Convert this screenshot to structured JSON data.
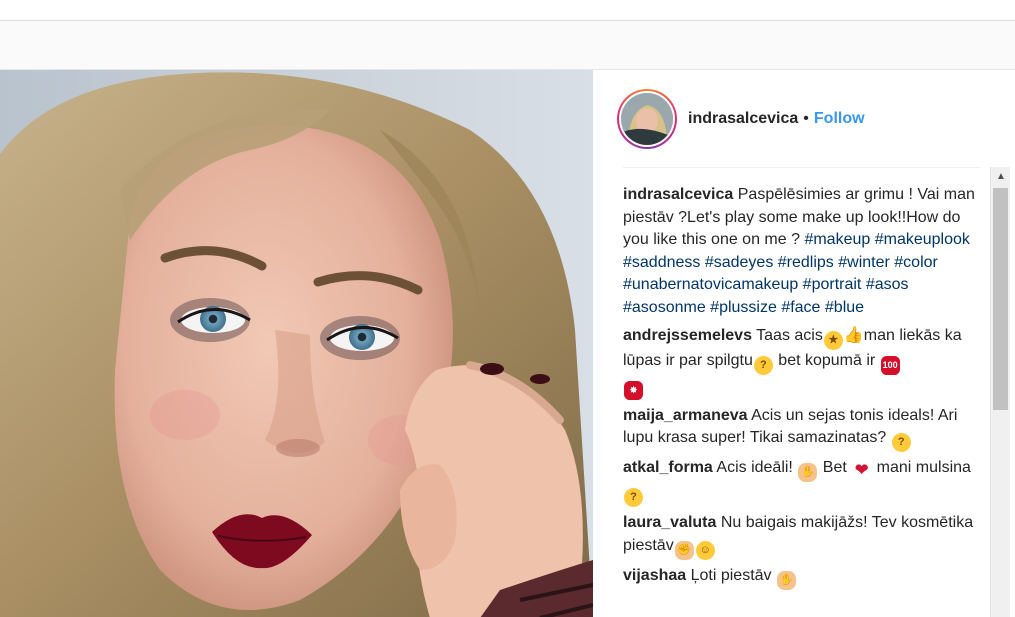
{
  "post": {
    "username": "indrasalcevica",
    "separator": "•",
    "follow_label": "Follow",
    "caption": {
      "username": "indrasalcevica",
      "text": "Paspēlēsimies ar grimu ! Vai man piestāv ?Let's play some make up look!!How do you like this one on me ?",
      "hashtags": "#makeup #makeuplook #saddness #sadeyes #redlips #winter #color #unabernatovicamakeup #portrait #asos #asosonme #plussize #face #blue"
    },
    "comments": [
      {
        "username": "andrejssemelevs",
        "parts": [
          "Taas acis",
          "👍man liekās ka lūpas ir par spilgtu",
          " bet kopumā ir "
        ],
        "emojis": [
          "star-struck",
          "thinking",
          "100",
          "collision"
        ]
      },
      {
        "username": "maija_armaneva",
        "text": "Acis un sejas tonis ideals! Ari lupu krasa super! Tikai samazinatas?",
        "emojis": [
          "thinking"
        ]
      },
      {
        "username": "atkal_forma",
        "parts": [
          "Acis ideāli!",
          " Bet ",
          " mani mulsina "
        ],
        "emojis": [
          "ok-hand",
          "kiss-lips",
          "thinking"
        ]
      },
      {
        "username": "laura_valuta",
        "text": "Nu baigais makijāžs! Tev kosmētika piestāv",
        "emojis": [
          "thumbs-up",
          "smiling-face"
        ]
      },
      {
        "username": "vijashaa",
        "text": "Ļoti piestāv",
        "emojis": [
          "ok-hand"
        ]
      }
    ]
  },
  "colors": {
    "follow": "#3897f0",
    "hashtag": "#003569",
    "lips": "#7d0a1f"
  },
  "icons": {
    "scroll_up": "chevron-up-icon"
  }
}
